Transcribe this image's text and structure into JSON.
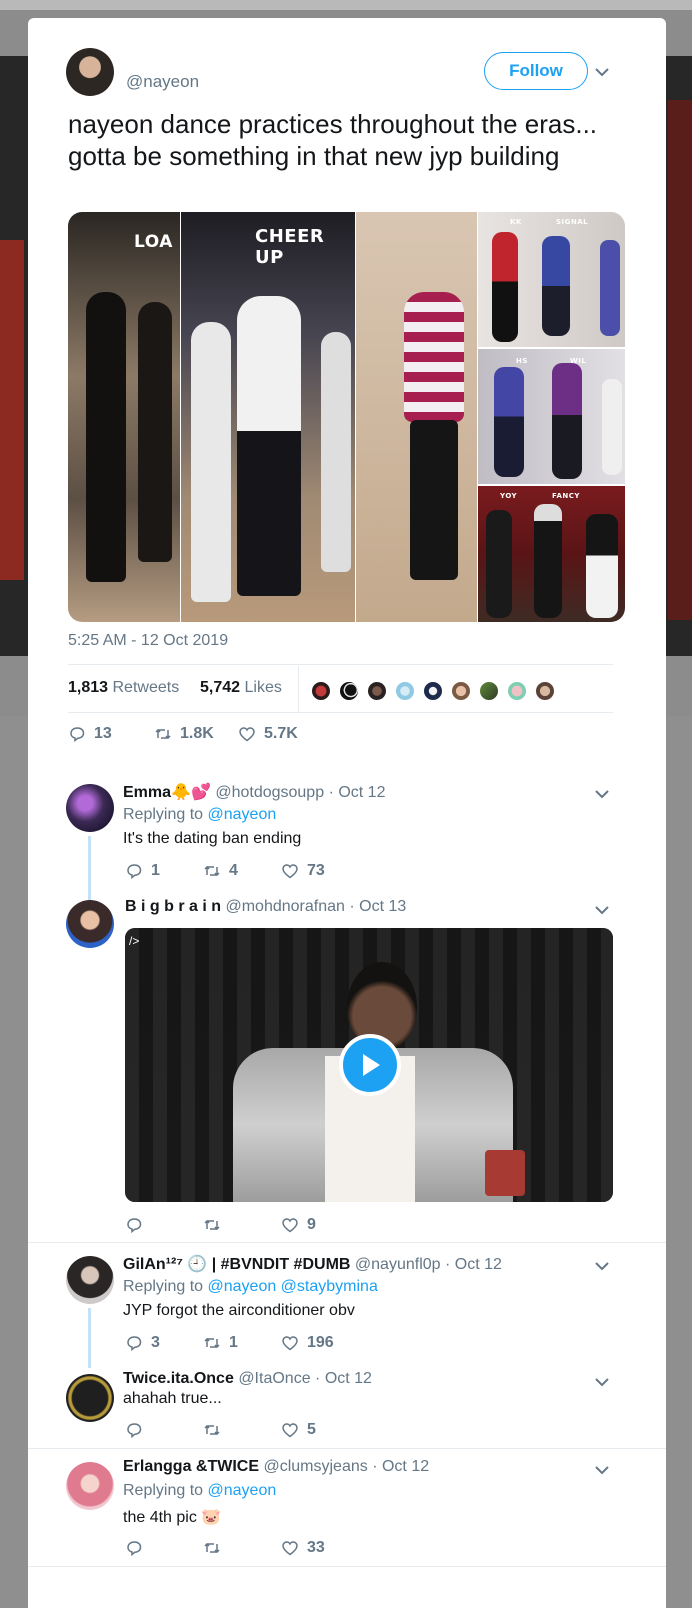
{
  "tweet": {
    "handle": "@nayeon",
    "follow_label": "Follow",
    "text": "nayeon dance practices throughout the eras... gotta be something in that new jyp building",
    "media_labels": [
      "LOA",
      "CHEER UP",
      "KK",
      "SIGNAL",
      "HS",
      "WIL",
      "YOY",
      "FANCY"
    ],
    "timestamp": "5:25 AM - 12 Oct 2019",
    "retweets_count": "1,813",
    "retweets_label": "Retweets",
    "likes_count": "5,742",
    "likes_label": "Likes",
    "actions": {
      "replies": "13",
      "retweets": "1.8K",
      "likes": "5.7K"
    }
  },
  "replies": [
    {
      "name": "Emma",
      "emoji": "🐥💕",
      "handle": "@hotdogsoupp",
      "date": "· Oct 12",
      "replying_label": "Replying to",
      "replying_to": "@nayeon",
      "text": "It's the dating ban ending",
      "replies": "1",
      "retweets": "4",
      "likes": "73"
    },
    {
      "name": "B i g b r a i n",
      "handle": "@mohdnorafnan",
      "date": "· Oct 13",
      "video_overlay": "/>",
      "likes": "9"
    },
    {
      "name": "GilAn¹²⁷ 🕘 | #BVNDIT #DUMB",
      "handle": "@nayunfl0p",
      "date": "· Oct 12",
      "replying_label": "Replying to",
      "replying_to": "@nayeon @staybymina",
      "text": "JYP forgot the airconditioner obv",
      "replies": "3",
      "retweets": "1",
      "likes": "196"
    },
    {
      "name": "Twice.ita.Once",
      "handle": "@ItaOnce",
      "date": "· Oct 12",
      "text": "ahahah true...",
      "likes": "5"
    },
    {
      "name": "Erlangga &TWICE",
      "handle": "@clumsyjeans",
      "date": "· Oct 12",
      "replying_label": "Replying to",
      "replying_to": "@nayeon",
      "text": "the 4th pic 🐷",
      "likes": "33"
    }
  ],
  "icons": [
    "chevron-down-icon",
    "reply-icon",
    "retweet-icon",
    "heart-icon",
    "play-icon"
  ],
  "colors": {
    "accent": "#1da1f2",
    "muted": "#657786",
    "thread": "#c4e1f5"
  }
}
